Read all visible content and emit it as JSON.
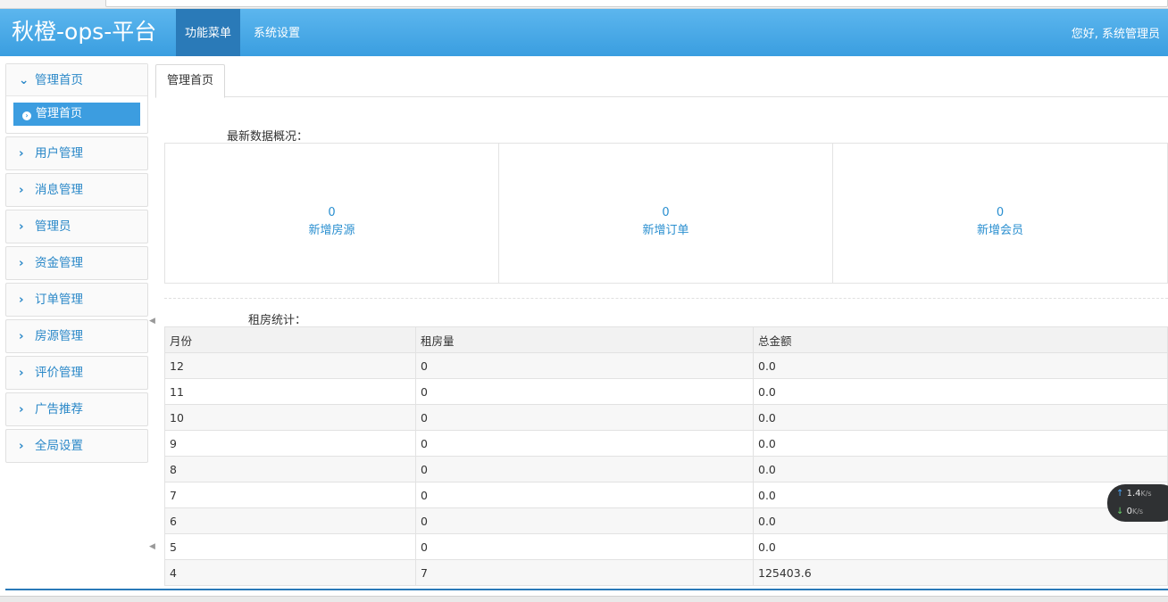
{
  "header": {
    "brand": "秋橙-ops-平台",
    "tabs": [
      {
        "label": "功能菜单",
        "active": true
      },
      {
        "label": "系统设置",
        "active": false
      }
    ],
    "greeting": "您好, 系统管理员"
  },
  "sidebar": {
    "open_group": {
      "label": "管理首页",
      "sub_item": "管理首页"
    },
    "groups": [
      {
        "label": "用户管理"
      },
      {
        "label": "消息管理"
      },
      {
        "label": "管理员"
      },
      {
        "label": "资金管理"
      },
      {
        "label": "订单管理"
      },
      {
        "label": "房源管理"
      },
      {
        "label": "评价管理"
      },
      {
        "label": "广告推荐"
      },
      {
        "label": "全局设置"
      }
    ]
  },
  "content": {
    "tab": "管理首页",
    "stats_title": "最新数据概况：",
    "stats": [
      {
        "value": "0",
        "label": "新增房源"
      },
      {
        "value": "0",
        "label": "新增订单"
      },
      {
        "value": "0",
        "label": "新增会员"
      }
    ],
    "rent_title": "租房统计：",
    "table": {
      "headers": [
        "月份",
        "租房量",
        "总金额"
      ],
      "rows": [
        [
          "12",
          "0",
          "0.0"
        ],
        [
          "11",
          "0",
          "0.0"
        ],
        [
          "10",
          "0",
          "0.0"
        ],
        [
          "9",
          "0",
          "0.0"
        ],
        [
          "8",
          "0",
          "0.0"
        ],
        [
          "7",
          "0",
          "0.0"
        ],
        [
          "6",
          "0",
          "0.0"
        ],
        [
          "5",
          "0",
          "0.0"
        ],
        [
          "4",
          "7",
          "125403.6"
        ]
      ]
    }
  },
  "speed_widget": {
    "up_value": "1.4",
    "up_unit": "K/s",
    "down_value": "0",
    "down_unit": "K/s"
  }
}
